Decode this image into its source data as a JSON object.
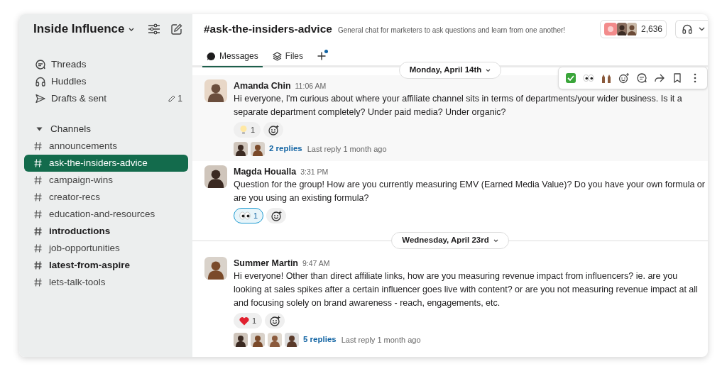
{
  "workspace": {
    "name": "Inside Influence"
  },
  "sidebar": {
    "items": [
      {
        "kind": "threads",
        "label": "Threads"
      },
      {
        "kind": "huddles",
        "label": "Huddles"
      },
      {
        "kind": "drafts",
        "label": "Drafts & sent",
        "count": "1"
      }
    ],
    "channels_header": {
      "label": "Channels",
      "expanded": true
    },
    "channels": [
      {
        "name": "announcements",
        "selected": false,
        "unread": false
      },
      {
        "name": "ask-the-insiders-advice",
        "selected": true,
        "unread": false
      },
      {
        "name": "campaign-wins",
        "selected": false,
        "unread": false
      },
      {
        "name": "creator-recs",
        "selected": false,
        "unread": false
      },
      {
        "name": "education-and-resources",
        "selected": false,
        "unread": false
      },
      {
        "name": "introductions",
        "selected": false,
        "unread": true
      },
      {
        "name": "job-opportunities",
        "selected": false,
        "unread": false
      },
      {
        "name": "latest-from-aspire",
        "selected": false,
        "unread": true
      },
      {
        "name": "lets-talk-tools",
        "selected": false,
        "unread": false
      }
    ]
  },
  "channel": {
    "title": "#ask-the-insiders-advice",
    "description": "General chat for marketers to ask questions and learn from one another!",
    "member_count": "2,636"
  },
  "tabs": [
    {
      "kind": "messages",
      "label": "Messages",
      "selected": true
    },
    {
      "kind": "files",
      "label": "Files",
      "selected": false
    },
    {
      "kind": "add",
      "selected": false,
      "badge": true
    }
  ],
  "feed": [
    {
      "kind": "date",
      "label": "Monday, April 14th"
    },
    {
      "kind": "message",
      "author": "Amanda Chin",
      "time": "11:06 AM",
      "hovered": true,
      "text": "Hi everyone, I'm curious about where your affiliate channel sits in terms of departments/your wider business. Is it a separate department completely? Under paid media? Under organic?",
      "reactions": [
        {
          "kind": "bulb",
          "count": "1",
          "selected": false
        }
      ],
      "thread": {
        "replies": "2 replies",
        "last": "Last reply 1 month ago"
      }
    },
    {
      "kind": "message",
      "author": "Magda Houalla",
      "time": "3:31 PM",
      "hovered": false,
      "text": "Question for the group! How are you currently measuring EMV (Earned Media Value)? Do you have your own formula or are you using an existing formula?",
      "reactions": [
        {
          "kind": "eyes",
          "count": "1",
          "selected": true
        }
      ]
    },
    {
      "kind": "date",
      "label": "Wednesday, April 23rd"
    },
    {
      "kind": "message",
      "author": "Summer Martin",
      "time": "9:47 AM",
      "hovered": false,
      "text": "Hi everyone! Other than direct affiliate links, how are you measuring revenue impact from influencers? ie. are you looking at sales spikes after a certain influencer goes live with content? or are you not measuring revenue impact at all and focusing solely on brand awareness - reach, engagements, etc.",
      "reactions": [
        {
          "kind": "heart",
          "count": "1",
          "selected": false
        }
      ],
      "thread": {
        "replies": "5 replies",
        "last": "Last reply 1 month ago"
      }
    }
  ]
}
